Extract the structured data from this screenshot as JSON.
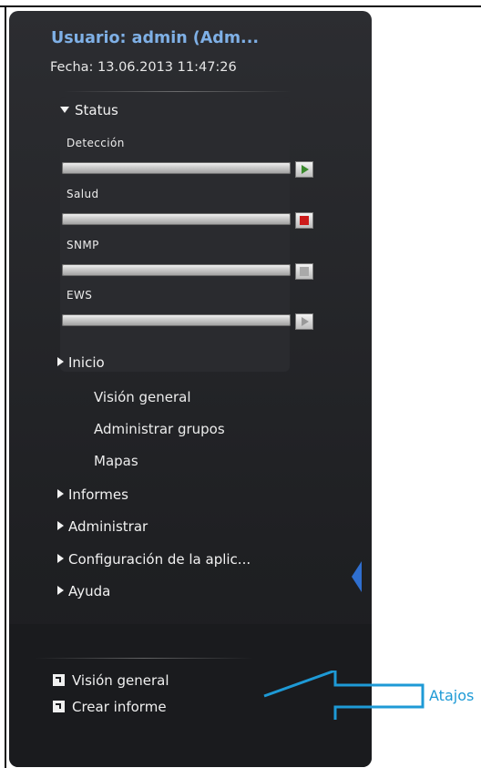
{
  "header": {
    "user_title": "Usuario: admin (Adm...",
    "date": "Fecha: 13.06.2013 11:47:26"
  },
  "status": {
    "heading": "Status",
    "items": [
      {
        "label": "Detección",
        "control": "play-icon",
        "state": "active"
      },
      {
        "label": "Salud",
        "control": "stop-icon",
        "state": "active"
      },
      {
        "label": "SNMP",
        "control": "stop-icon",
        "state": "disabled"
      },
      {
        "label": "EWS",
        "control": "play-icon",
        "state": "disabled"
      }
    ]
  },
  "nav": {
    "inicio": {
      "label": "Inicio",
      "items": [
        "Visión general",
        "Administrar grupos",
        "Mapas"
      ]
    },
    "informes": "Informes",
    "administrar": "Administrar",
    "configuracion": "Configuración de la aplic...",
    "ayuda": "Ayuda"
  },
  "shortcuts": {
    "items": [
      "Visión general",
      "Crear informe"
    ],
    "callout_label": "Atajos"
  },
  "colors": {
    "title_blue": "#7fb0e6",
    "panel_bg": "#1f2023",
    "play_green": "#3b8a2e",
    "stop_red": "#cc1a1a",
    "callout_blue": "#1e9ad6",
    "handle_blue": "#2f6fd0"
  }
}
